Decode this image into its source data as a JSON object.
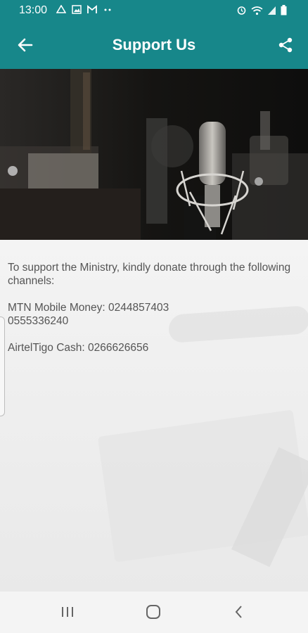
{
  "status_bar": {
    "time": "13:00",
    "left_icons": [
      "drive-icon",
      "image-icon",
      "gmail-icon",
      "more-dots-icon"
    ],
    "right_icons": [
      "alarm-icon",
      "wifi-icon",
      "signal-icon",
      "battery-icon"
    ]
  },
  "app_bar": {
    "title": "Support Us",
    "color": "#17878a"
  },
  "content": {
    "intro": "To support the Ministry, kindly donate through the following channels:",
    "mtn_line": "MTN Mobile Money: 0244857403",
    "mtn_line2": "0555336240",
    "airteltigo": "AirtelTigo Cash: 0266626656"
  },
  "nav_bar": {
    "buttons": [
      "recent-apps",
      "home",
      "back"
    ]
  }
}
